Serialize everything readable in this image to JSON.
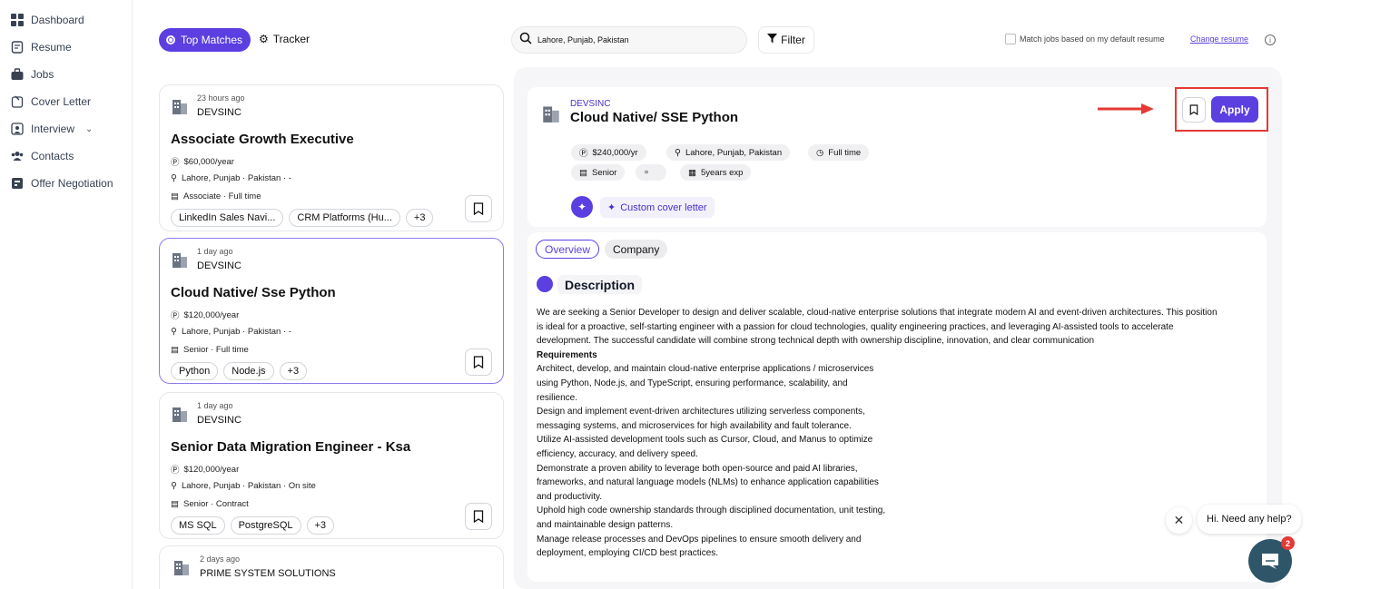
{
  "sidebar": {
    "items": [
      {
        "label": "Dashboard",
        "icon": "grid-icon"
      },
      {
        "label": "Resume",
        "icon": "document-icon"
      },
      {
        "label": "Jobs",
        "icon": "briefcase-icon"
      },
      {
        "label": "Cover Letter",
        "icon": "cover-letter-icon"
      },
      {
        "label": "Interview",
        "icon": "interview-icon"
      },
      {
        "label": "Contacts",
        "icon": "contacts-icon"
      },
      {
        "label": "Offer Negotiation",
        "icon": "offer-icon"
      }
    ]
  },
  "topbar": {
    "top_matches": "Top Matches",
    "tracker": "Tracker",
    "search_value": "Lahore, Punjab, Pakistan",
    "filter": "Filter",
    "match_label": "Match jobs based on my default resume",
    "change_resume": "Change resume"
  },
  "jobs": [
    {
      "ago": "23 hours ago",
      "company": "DEVSINC",
      "title": "Associate Growth Executive",
      "salary": "$60,000/year",
      "location": "Lahore, Punjab · Pakistan · -",
      "level": "Associate · Full time",
      "tags": [
        "LinkedIn Sales Navi...",
        "CRM Platforms (Hu...",
        "+3"
      ]
    },
    {
      "ago": "1 day ago",
      "company": "DEVSINC",
      "title": "Cloud Native/ Sse Python",
      "salary": "$120,000/year",
      "location": "Lahore, Punjab · Pakistan · -",
      "level": "Senior · Full time",
      "tags": [
        "Python",
        "Node.js",
        "+3"
      ]
    },
    {
      "ago": "1 day ago",
      "company": "DEVSINC",
      "title": "Senior Data Migration Engineer - Ksa",
      "salary": "$120,000/year",
      "location": "Lahore, Punjab · Pakistan · On site",
      "level": "Senior · Contract",
      "tags": [
        "MS SQL",
        "PostgreSQL",
        "+3"
      ]
    },
    {
      "ago": "2 days ago",
      "company": "PRIME SYSTEM SOLUTIONS"
    }
  ],
  "detail": {
    "company": "DEVSINC",
    "title": "Cloud Native/ SSE Python",
    "salary": "$240,000/yr",
    "location": "Lahore, Punjab, Pakistan",
    "type": "Full time",
    "level": "Senior",
    "misc": "",
    "experience": "5years exp",
    "cover_letter": "Custom cover letter",
    "apply": "Apply",
    "tab_overview": "Overview",
    "tab_company": "Company",
    "description_heading": "Description",
    "description_lines": [
      "We are seeking a Senior Developer to design and deliver scalable, cloud-native enterprise solutions that integrate modern AI and event-driven architectures. This position",
      "is ideal for a proactive, self-starting engineer with a passion for cloud technologies, quality engineering practices, and leveraging AI-assisted tools to accelerate",
      "development. The successful candidate will combine strong technical depth with ownership discipline, innovation, and clear communication"
    ],
    "requirements_heading": "Requirements",
    "requirements_lines": [
      "Architect, develop, and maintain cloud-native enterprise applications / microservices",
      "using Python, Node.js, and TypeScript, ensuring performance, scalability, and",
      "resilience.",
      "Design and implement event-driven architectures utilizing serverless components,",
      "messaging systems, and microservices for high availability and fault tolerance.",
      "Utilize AI-assisted development tools such as Cursor, Cloud, and Manus to optimize",
      "efficiency, accuracy, and delivery speed.",
      "Demonstrate a proven ability to leverage both open-source and paid AI libraries,",
      "frameworks, and natural language models (NLMs) to enhance application capabilities",
      "and productivity.",
      "Uphold high code ownership standards through disciplined documentation, unit testing,",
      "and maintainable design patterns.",
      "Manage release processes and DevOps pipelines to ensure smooth delivery and",
      "deployment, employing CI/CD best practices."
    ]
  },
  "chat": {
    "greeting": "Hi. Need any help?",
    "badge": "2"
  },
  "colors": {
    "accent": "#5b3fe0",
    "highlight": "#e53935"
  }
}
